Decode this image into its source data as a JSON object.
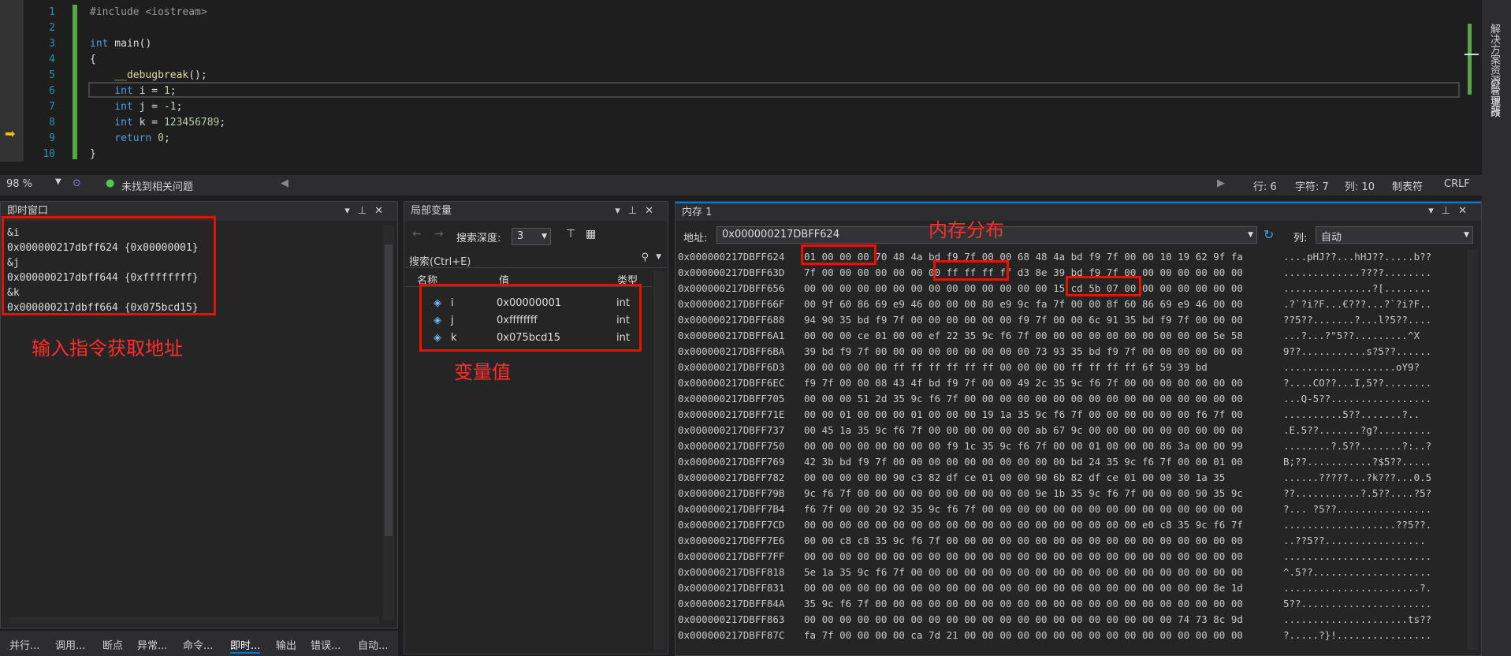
{
  "editor": {
    "line_numbers": [
      "1",
      "2",
      "3",
      "4",
      "5",
      "6",
      "7",
      "8",
      "9",
      "10"
    ],
    "code": [
      {
        "parts": [
          {
            "t": "#include <iostream>",
            "c": "pp"
          }
        ]
      },
      {
        "parts": []
      },
      {
        "parts": [
          {
            "t": "int",
            "c": "kw"
          },
          {
            "t": " main()",
            "c": ""
          }
        ]
      },
      {
        "parts": [
          {
            "t": "{",
            "c": ""
          }
        ]
      },
      {
        "parts": [
          {
            "t": "    __debugbreak",
            "c": "fn"
          },
          {
            "t": "();",
            "c": ""
          }
        ]
      },
      {
        "parts": [
          {
            "t": "    int",
            "c": "kw"
          },
          {
            "t": " i = ",
            "c": ""
          },
          {
            "t": "1",
            "c": "num"
          },
          {
            "t": ";",
            "c": ""
          }
        ]
      },
      {
        "parts": [
          {
            "t": "    int",
            "c": "kw"
          },
          {
            "t": " j = -",
            "c": ""
          },
          {
            "t": "1",
            "c": "num"
          },
          {
            "t": ";",
            "c": ""
          }
        ]
      },
      {
        "parts": [
          {
            "t": "    int",
            "c": "kw"
          },
          {
            "t": " k = ",
            "c": ""
          },
          {
            "t": "123456789",
            "c": "num"
          },
          {
            "t": ";",
            "c": ""
          }
        ]
      },
      {
        "parts": [
          {
            "t": "    return",
            "c": "kw"
          },
          {
            "t": " ",
            "c": ""
          },
          {
            "t": "0",
            "c": "num"
          },
          {
            "t": ";",
            "c": ""
          }
        ]
      },
      {
        "parts": [
          {
            "t": "}",
            "c": ""
          }
        ]
      }
    ],
    "current_arrow": "➡"
  },
  "status": {
    "zoom": "98 %",
    "issues": "未找到相关问题",
    "line": "行: 6",
    "char": "字符: 7",
    "col": "列: 10",
    "tabs": "制表符",
    "eol": "CRLF"
  },
  "right_tabs": [
    "解决方案资源管理器",
    "Git 更改"
  ],
  "immediate": {
    "title": "即时窗口",
    "lines": [
      "&i",
      "0x000000217dbff624 {0x00000001}",
      "&j",
      "0x000000217dbff644 {0xffffffff}",
      "&k",
      "0x000000217dbff664 {0x075bcd15}"
    ],
    "annotation": "输入指令获取地址"
  },
  "bottom_tabs": [
    "并行...",
    "调用...",
    "断点",
    "异常...",
    "命令...",
    "即时...",
    "输出",
    "错误...",
    "自动..."
  ],
  "locals": {
    "title": "局部变量",
    "depth_label": "搜索深度:",
    "depth_value": "3",
    "search_placeholder": "搜索(Ctrl+E)",
    "headers": [
      "名称",
      "值",
      "类型"
    ],
    "rows": [
      {
        "name": "i",
        "value": "0x00000001",
        "type": "int"
      },
      {
        "name": "j",
        "value": "0xffffffff",
        "type": "int"
      },
      {
        "name": "k",
        "value": "0x075bcd15",
        "type": "int"
      }
    ],
    "annotation": "变量值"
  },
  "memory": {
    "title": "内存 1",
    "address_label": "地址:",
    "address": "0x000000217DBFF624",
    "column_label": "列:",
    "column_value": "自动",
    "annotation": "内存分布",
    "rows": [
      {
        "a": "0x000000217DBFF624",
        "b": "01 00 00 00 70 48 4a bd f9 7f 00 00 68 48 4a bd f9 7f 00 00 10 19 62 9f fa",
        "s": "....pHJ??...hHJ??.....b??"
      },
      {
        "a": "0x000000217DBFF63D",
        "b": "7f 00 00 00 00 00 00 00 ff ff ff ff d3 8e 39 bd f9 7f 00 00 00 00 00 00 00",
        "s": ".............????........"
      },
      {
        "a": "0x000000217DBFF656",
        "b": "00 00 00 00 00 00 00 00 00 00 00 00 00 00 15 cd 5b 07 00 00 00 00 00 00 00",
        "s": "...............?[........"
      },
      {
        "a": "0x000000217DBFF66F",
        "b": "00 9f 60 86 69 e9 46 00 00 00 80 e9 9c fa 7f 00 00 8f 60 86 69 e9 46 00 00",
        "s": ".?`?i?F...€???...?`?i?F.."
      },
      {
        "a": "0x000000217DBFF688",
        "b": "94 90 35 bd f9 7f 00 00 00 00 00 00 f9 7f 00 00 6c 91 35 bd f9 7f 00 00 00",
        "s": "??5??.......?...l?5??...."
      },
      {
        "a": "0x000000217DBFF6A1",
        "b": "00 00 00 ce 01 00 00 ef 22 35 9c f6 7f 00 00 00 00 00 00 00 00 00 00 5e 58",
        "s": "...?...?\"5??.........^X"
      },
      {
        "a": "0x000000217DBFF6BA",
        "b": "39 bd f9 7f 00 00 00 00 00 00 00 00 00 73 93 35 bd f9 7f 00 00 00 00 00 00",
        "s": "9??...........s?5??......"
      },
      {
        "a": "0x000000217DBFF6D3",
        "b": "00 00 00 00 00 ff ff ff ff ff ff 00 00 00 00 ff ff ff ff 6f 59 39 bd",
        "s": "...................oY9?"
      },
      {
        "a": "0x000000217DBFF6EC",
        "b": "f9 7f 00 00 08 43 4f bd f9 7f 00 00 49 2c 35 9c f6 7f 00 00 00 00 00 00 00",
        "s": "?....CO??...I,5??........"
      },
      {
        "a": "0x000000217DBFF705",
        "b": "00 00 00 51 2d 35 9c f6 7f 00 00 00 00 00 00 00 00 00 00 00 00 00 00 00 00",
        "s": "...Q-5??................."
      },
      {
        "a": "0x000000217DBFF71E",
        "b": "00 00 01 00 00 00 01 00 00 00 19 1a 35 9c f6 7f 00 00 00 00 00 00 f6 7f 00",
        "s": "..........5??.......?.."
      },
      {
        "a": "0x000000217DBFF737",
        "b": "00 45 1a 35 9c f6 7f 00 00 00 00 00 00 ab 67 9c 00 00 00 00 00 00 00 00 00",
        "s": ".E.5??.......?g?........."
      },
      {
        "a": "0x000000217DBFF750",
        "b": "00 00 00 00 00 00 00 00 f9 1c 35 9c f6 7f 00 00 01 00 00 00 86 3a 00 00 99",
        "s": "........?.5??.......?:..?"
      },
      {
        "a": "0x000000217DBFF769",
        "b": "42 3b bd f9 7f 00 00 00 00 00 00 00 00 00 00 bd 24 35 9c f6 7f 00 00 01 00",
        "s": "B;??...........?$5??....."
      },
      {
        "a": "0x000000217DBFF782",
        "b": "00 00 00 00 00 90 c3 82 df ce 01 00 00 90 6b 82 df ce 01 00 00 30 1a 35",
        "s": "......?????...?k???...0.5"
      },
      {
        "a": "0x000000217DBFF79B",
        "b": "9c f6 7f 00 00 00 00 00 00 00 00 00 00 9e 1b 35 9c f6 7f 00 00 00 90 35 9c",
        "s": "??...........?.5??....?5?"
      },
      {
        "a": "0x000000217DBFF7B4",
        "b": "f6 7f 00 00 20 92 35 9c f6 7f 00 00 00 00 00 00 00 00 00 00 00 00 00 00 00",
        "s": "?... ?5??................"
      },
      {
        "a": "0x000000217DBFF7CD",
        "b": "00 00 00 00 00 00 00 00 00 00 00 00 00 00 00 00 00 00 00 e0 c8 35 9c f6 7f",
        "s": "...................??5??."
      },
      {
        "a": "0x000000217DBFF7E6",
        "b": "00 00 c8 c8 35 9c f6 7f 00 00 00 00 00 00 00 00 00 00 00 00 00 00 00 00 00",
        "s": "..??5??................."
      },
      {
        "a": "0x000000217DBFF7FF",
        "b": "00 00 00 00 00 00 00 00 00 00 00 00 00 00 00 00 00 00 00 00 00 00 00 00 00",
        "s": "........................."
      },
      {
        "a": "0x000000217DBFF818",
        "b": "5e 1a 35 9c f6 7f 00 00 00 00 00 00 00 00 00 00 00 00 00 00 00 00 00 00 00",
        "s": "^.5??...................."
      },
      {
        "a": "0x000000217DBFF831",
        "b": "00 00 00 00 00 00 00 00 00 00 00 00 00 00 00 00 00 00 00 00 00 00 00 8e 1d",
        "s": ".......................?."
      },
      {
        "a": "0x000000217DBFF84A",
        "b": "35 9c f6 7f 00 00 00 00 00 00 00 00 00 00 00 00 00 00 00 00 00 00 00 00 00",
        "s": "5??......................"
      },
      {
        "a": "0x000000217DBFF863",
        "b": "00 00 00 00 00 00 00 00 00 00 00 00 00 00 00 00 00 00 00 00 00 74 73 8c 9d",
        "s": ".....................ts??"
      },
      {
        "a": "0x000000217DBFF87C",
        "b": "fa 7f 00 00 00 00 ca 7d 21 00 00 00 00 00 00 00 00 00 00 00 00 00 00 00 00",
        "s": "?.....?}!................"
      }
    ]
  }
}
